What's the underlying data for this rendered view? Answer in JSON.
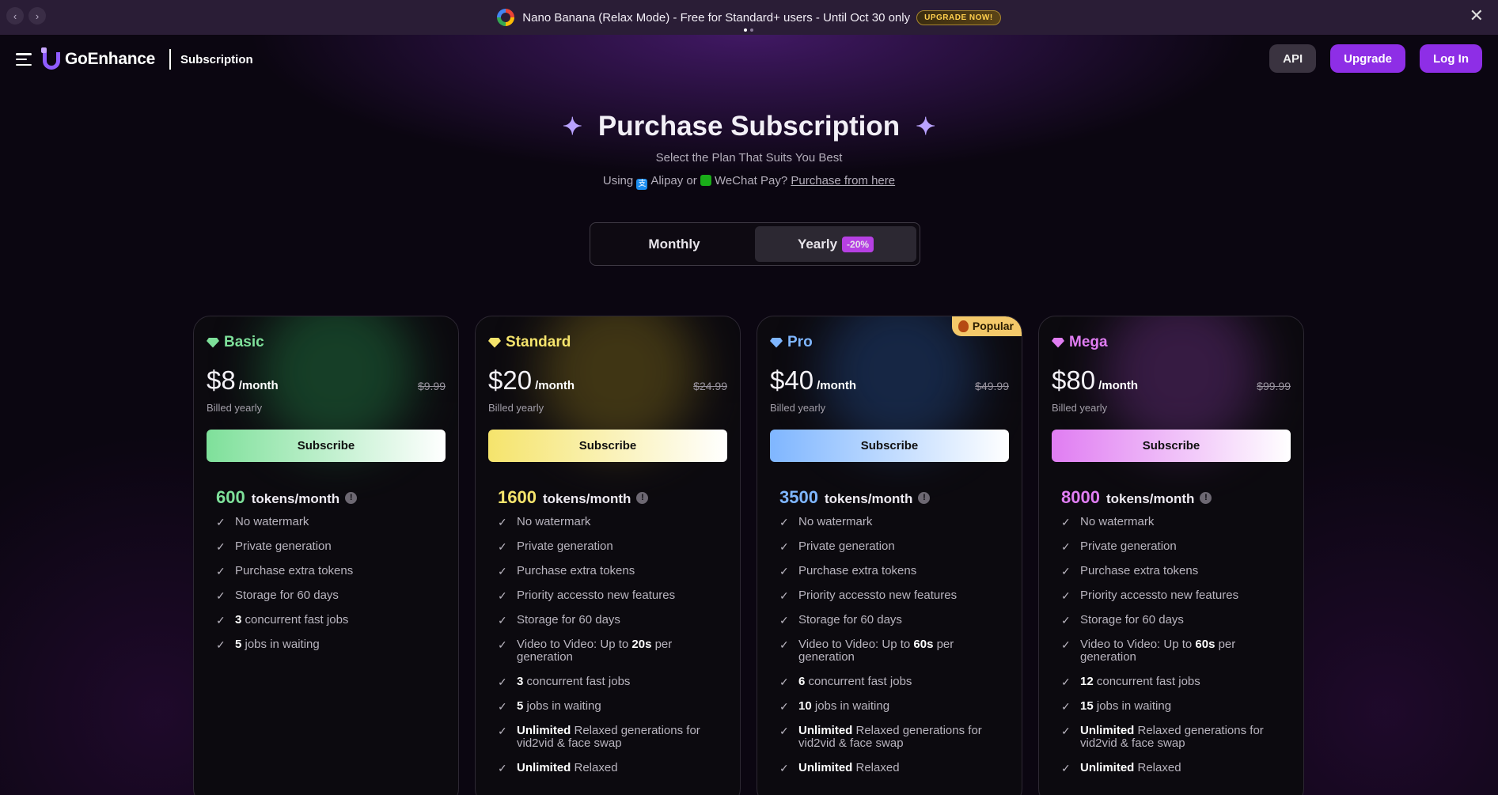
{
  "banner": {
    "text": "Nano Banana (Relax Mode) - Free for Standard+ users - Until Oct 30 only",
    "cta": "UPGRADE NOW!"
  },
  "header": {
    "brand": "GoEnhance",
    "crumb": "Subscription",
    "api": "API",
    "upgrade": "Upgrade",
    "login": "Log In"
  },
  "hero": {
    "title": "Purchase Subscription",
    "subtitle": "Select the Plan That Suits You Best",
    "pay_prefix": "Using",
    "alipay": "Alipay or",
    "wechat": "WeChat Pay?",
    "link": "Purchase from here"
  },
  "toggle": {
    "monthly": "Monthly",
    "yearly": "Yearly",
    "discount": "-20%"
  },
  "colors": {
    "accent": "#8e2ee6",
    "basic": "#7ee09a",
    "standard": "#f5e46c",
    "pro": "#7fb6ff",
    "mega": "#e07df2"
  },
  "plans": [
    {
      "name": "Basic",
      "price": "$8",
      "per": "/month",
      "old": "$9.99",
      "billed": "Billed yearly",
      "cta": "Subscribe",
      "tokens": "600",
      "tokens_unit": "tokens/month",
      "features": [
        {
          "b": "",
          "t": "No watermark"
        },
        {
          "b": "",
          "t": "Private generation"
        },
        {
          "b": "",
          "t": "Purchase extra tokens"
        },
        {
          "b": "",
          "t": "Storage for 60 days"
        },
        {
          "b": "3",
          "t": " concurrent fast jobs"
        },
        {
          "b": "5",
          "t": " jobs in waiting"
        }
      ]
    },
    {
      "name": "Standard",
      "price": "$20",
      "per": "/month",
      "old": "$24.99",
      "billed": "Billed yearly",
      "cta": "Subscribe",
      "tokens": "1600",
      "tokens_unit": "tokens/month",
      "features": [
        {
          "b": "",
          "t": "No watermark"
        },
        {
          "b": "",
          "t": "Private generation"
        },
        {
          "b": "",
          "t": "Purchase extra tokens"
        },
        {
          "b": "",
          "t": "Priority accessto new features"
        },
        {
          "b": "",
          "t": "Storage for 60 days"
        },
        {
          "pre": "Video to Video: Up to ",
          "b": "20s",
          "t": " per generation"
        },
        {
          "b": "3",
          "t": " concurrent fast jobs"
        },
        {
          "b": "5",
          "t": " jobs in waiting"
        },
        {
          "b": "Unlimited",
          "t": " Relaxed generations for vid2vid & face swap"
        },
        {
          "b": "Unlimited",
          "t": " Relaxed"
        }
      ]
    },
    {
      "name": "Pro",
      "price": "$40",
      "per": "/month",
      "old": "$49.99",
      "billed": "Billed yearly",
      "cta": "Subscribe",
      "tokens": "3500",
      "tokens_unit": "tokens/month",
      "popular": "Popular",
      "features": [
        {
          "b": "",
          "t": "No watermark"
        },
        {
          "b": "",
          "t": "Private generation"
        },
        {
          "b": "",
          "t": "Purchase extra tokens"
        },
        {
          "b": "",
          "t": "Priority accessto new features"
        },
        {
          "b": "",
          "t": "Storage for 60 days"
        },
        {
          "pre": "Video to Video: Up to ",
          "b": "60s",
          "t": " per generation"
        },
        {
          "b": "6",
          "t": " concurrent fast jobs"
        },
        {
          "b": "10",
          "t": " jobs in waiting"
        },
        {
          "b": "Unlimited",
          "t": " Relaxed generations for vid2vid & face swap"
        },
        {
          "b": "Unlimited",
          "t": " Relaxed"
        }
      ]
    },
    {
      "name": "Mega",
      "price": "$80",
      "per": "/month",
      "old": "$99.99",
      "billed": "Billed yearly",
      "cta": "Subscribe",
      "tokens": "8000",
      "tokens_unit": "tokens/month",
      "features": [
        {
          "b": "",
          "t": "No watermark"
        },
        {
          "b": "",
          "t": "Private generation"
        },
        {
          "b": "",
          "t": "Purchase extra tokens"
        },
        {
          "b": "",
          "t": "Priority accessto new features"
        },
        {
          "b": "",
          "t": "Storage for 60 days"
        },
        {
          "pre": "Video to Video: Up to ",
          "b": "60s",
          "t": " per generation"
        },
        {
          "b": "12",
          "t": " concurrent fast jobs"
        },
        {
          "b": "15",
          "t": " jobs in waiting"
        },
        {
          "b": "Unlimited",
          "t": " Relaxed generations for vid2vid & face swap"
        },
        {
          "b": "Unlimited",
          "t": " Relaxed"
        }
      ]
    }
  ]
}
